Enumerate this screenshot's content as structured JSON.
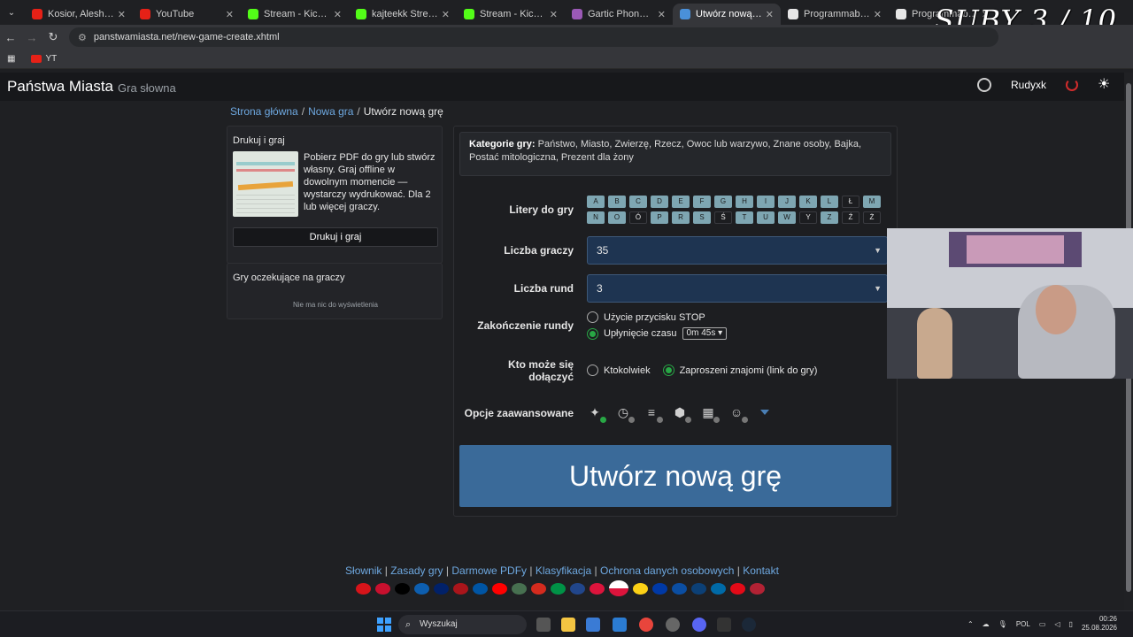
{
  "browser": {
    "tabs": [
      {
        "title": "Kosior, Aleshen",
        "fav": "#e62117",
        "active": false
      },
      {
        "title": "YouTube",
        "fav": "#e62117",
        "active": false
      },
      {
        "title": "Stream - Kick Dashbo",
        "fav": "#53fc18",
        "active": false
      },
      {
        "title": "kajteekk Stream - Wa",
        "fav": "#53fc18",
        "active": false
      },
      {
        "title": "Stream - Kick Dashbo",
        "fav": "#53fc18",
        "active": false
      },
      {
        "title": "Gartic Phone - Gra w",
        "fav": "#9b59b6",
        "active": false
      },
      {
        "title": "Utwórz nową grę",
        "fav": "#4a90d9",
        "active": true
      },
      {
        "title": "Programmable Searc",
        "fav": "#e6e6e6",
        "active": false
      },
      {
        "title": "Programmable Searc",
        "fav": "#e6e6e6",
        "active": false
      }
    ],
    "overlay_title": "SUBY 3 / 10",
    "url": "panstwamiasta.net/new-game-create.xhtml",
    "bookmark": "YT"
  },
  "header": {
    "brand": "Państwa Miasta",
    "brand_sub": "Gra słowna",
    "user": "Rudyxk"
  },
  "breadcrumb": {
    "home": "Strona główna",
    "new_game": "Nowa gra",
    "current": "Utwórz nową grę"
  },
  "print_card": {
    "title": "Drukuj i graj",
    "text": "Pobierz PDF do gry lub stwórz własny. Graj offline w dowolnym momencie — wystarczy wydrukować. Dla 2 lub więcej graczy.",
    "button": "Drukuj i graj"
  },
  "waiting_card": {
    "title": "Gry oczekujące na graczy",
    "empty": "Nie ma nic do wyświetlenia"
  },
  "categories": {
    "label": "Kategorie gry:",
    "value": "Państwo, Miasto, Zwierzę, Rzecz, Owoc lub warzywo, Znane osoby, Bajka, Postać mitologiczna, Prezent dla żony"
  },
  "form": {
    "letters_label": "Litery do gry",
    "letters_row1": [
      {
        "l": "A",
        "on": true
      },
      {
        "l": "B",
        "on": true
      },
      {
        "l": "C",
        "on": true
      },
      {
        "l": "D",
        "on": true
      },
      {
        "l": "E",
        "on": true
      },
      {
        "l": "F",
        "on": true
      },
      {
        "l": "G",
        "on": true
      },
      {
        "l": "H",
        "on": true
      },
      {
        "l": "I",
        "on": true
      },
      {
        "l": "J",
        "on": true
      },
      {
        "l": "K",
        "on": true
      },
      {
        "l": "L",
        "on": true
      },
      {
        "l": "Ł",
        "on": false
      },
      {
        "l": "M",
        "on": true
      }
    ],
    "letters_row2": [
      {
        "l": "N",
        "on": true
      },
      {
        "l": "O",
        "on": true
      },
      {
        "l": "Ó",
        "on": false
      },
      {
        "l": "P",
        "on": true
      },
      {
        "l": "R",
        "on": true
      },
      {
        "l": "S",
        "on": true
      },
      {
        "l": "Ś",
        "on": false
      },
      {
        "l": "T",
        "on": true
      },
      {
        "l": "U",
        "on": true
      },
      {
        "l": "W",
        "on": true
      },
      {
        "l": "Y",
        "on": false
      },
      {
        "l": "Z",
        "on": true
      },
      {
        "l": "Ź",
        "on": false
      },
      {
        "l": "Ż",
        "on": false
      }
    ],
    "players_label": "Liczba graczy",
    "players_value": "35",
    "rounds_label": "Liczba rund",
    "rounds_value": "3",
    "end_label": "Zakończenie rundy",
    "end_opt1": "Użycie przycisku STOP",
    "end_opt2": "Upłynięcie czasu",
    "end_time": "0m 45s",
    "join_label_1": "Kto może się",
    "join_label_2": "dołączyć",
    "join_opt1": "Ktokolwiek",
    "join_opt2": "Zaproszeni znajomi (link do gry)",
    "advanced_label": "Opcje zaawansowane",
    "create_button": "Utwórz nową grę"
  },
  "advanced_icons": [
    {
      "name": "sparkles-icon",
      "glyph": "✦",
      "dot": "green"
    },
    {
      "name": "clock-icon",
      "glyph": "◷",
      "dot": "gray"
    },
    {
      "name": "list-edit-icon",
      "glyph": "≡",
      "dot": "gray"
    },
    {
      "name": "shield-icon",
      "glyph": "⬢",
      "dot": "gray"
    },
    {
      "name": "calendar-icon",
      "glyph": "▦",
      "dot": "gray"
    },
    {
      "name": "user-check-icon",
      "glyph": "☺",
      "dot": "gray"
    }
  ],
  "footer": {
    "links": [
      "Słownik",
      "Zasady gry",
      "Darmowe PDFy",
      "Klasyfikacja",
      "Ochrona danych osobowych",
      "Kontakt"
    ],
    "flags": [
      "#d7141a",
      "#c8102e",
      "#000000",
      "#0d5eaf",
      "#012169",
      "#aa151b",
      "#0055a4",
      "#ff0000",
      "#477050",
      "#d52b1e",
      "#009246",
      "#21468b",
      "#dc143c",
      "#006600",
      "#fcd116",
      "#0039a6",
      "#0b4ea2",
      "#0c4076",
      "#006aa7",
      "#e30a17",
      "#b22234"
    ]
  },
  "taskbar": {
    "search": "Wyszukaj",
    "lang": "POL",
    "time": "00:26",
    "date": "25.08.2026"
  }
}
